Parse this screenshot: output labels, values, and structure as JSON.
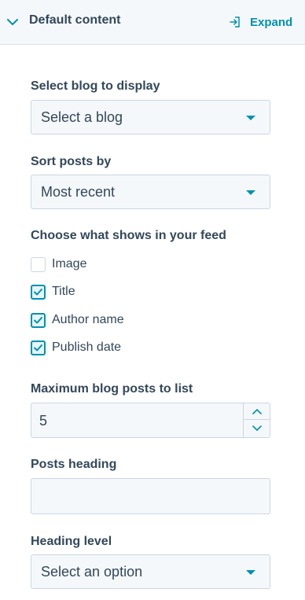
{
  "header": {
    "title": "Default content",
    "expand_label": "Expand",
    "chevron_icon": "chevron-down-icon",
    "expand_icon": "expand-icon",
    "accent_color": "#0091ae"
  },
  "blog_select": {
    "label": "Select blog to display",
    "value": "Select a blog"
  },
  "sort_select": {
    "label": "Sort posts by",
    "value": "Most recent"
  },
  "feed": {
    "label": "Choose what shows in your feed",
    "options": [
      {
        "label": "Image",
        "checked": false
      },
      {
        "label": "Title",
        "checked": true
      },
      {
        "label": "Author name",
        "checked": true
      },
      {
        "label": "Publish date",
        "checked": true
      }
    ]
  },
  "max_posts": {
    "label": "Maximum blog posts to list",
    "value": "5"
  },
  "posts_heading": {
    "label": "Posts heading",
    "value": ""
  },
  "heading_level": {
    "label": "Heading level",
    "value": "Select an option"
  }
}
